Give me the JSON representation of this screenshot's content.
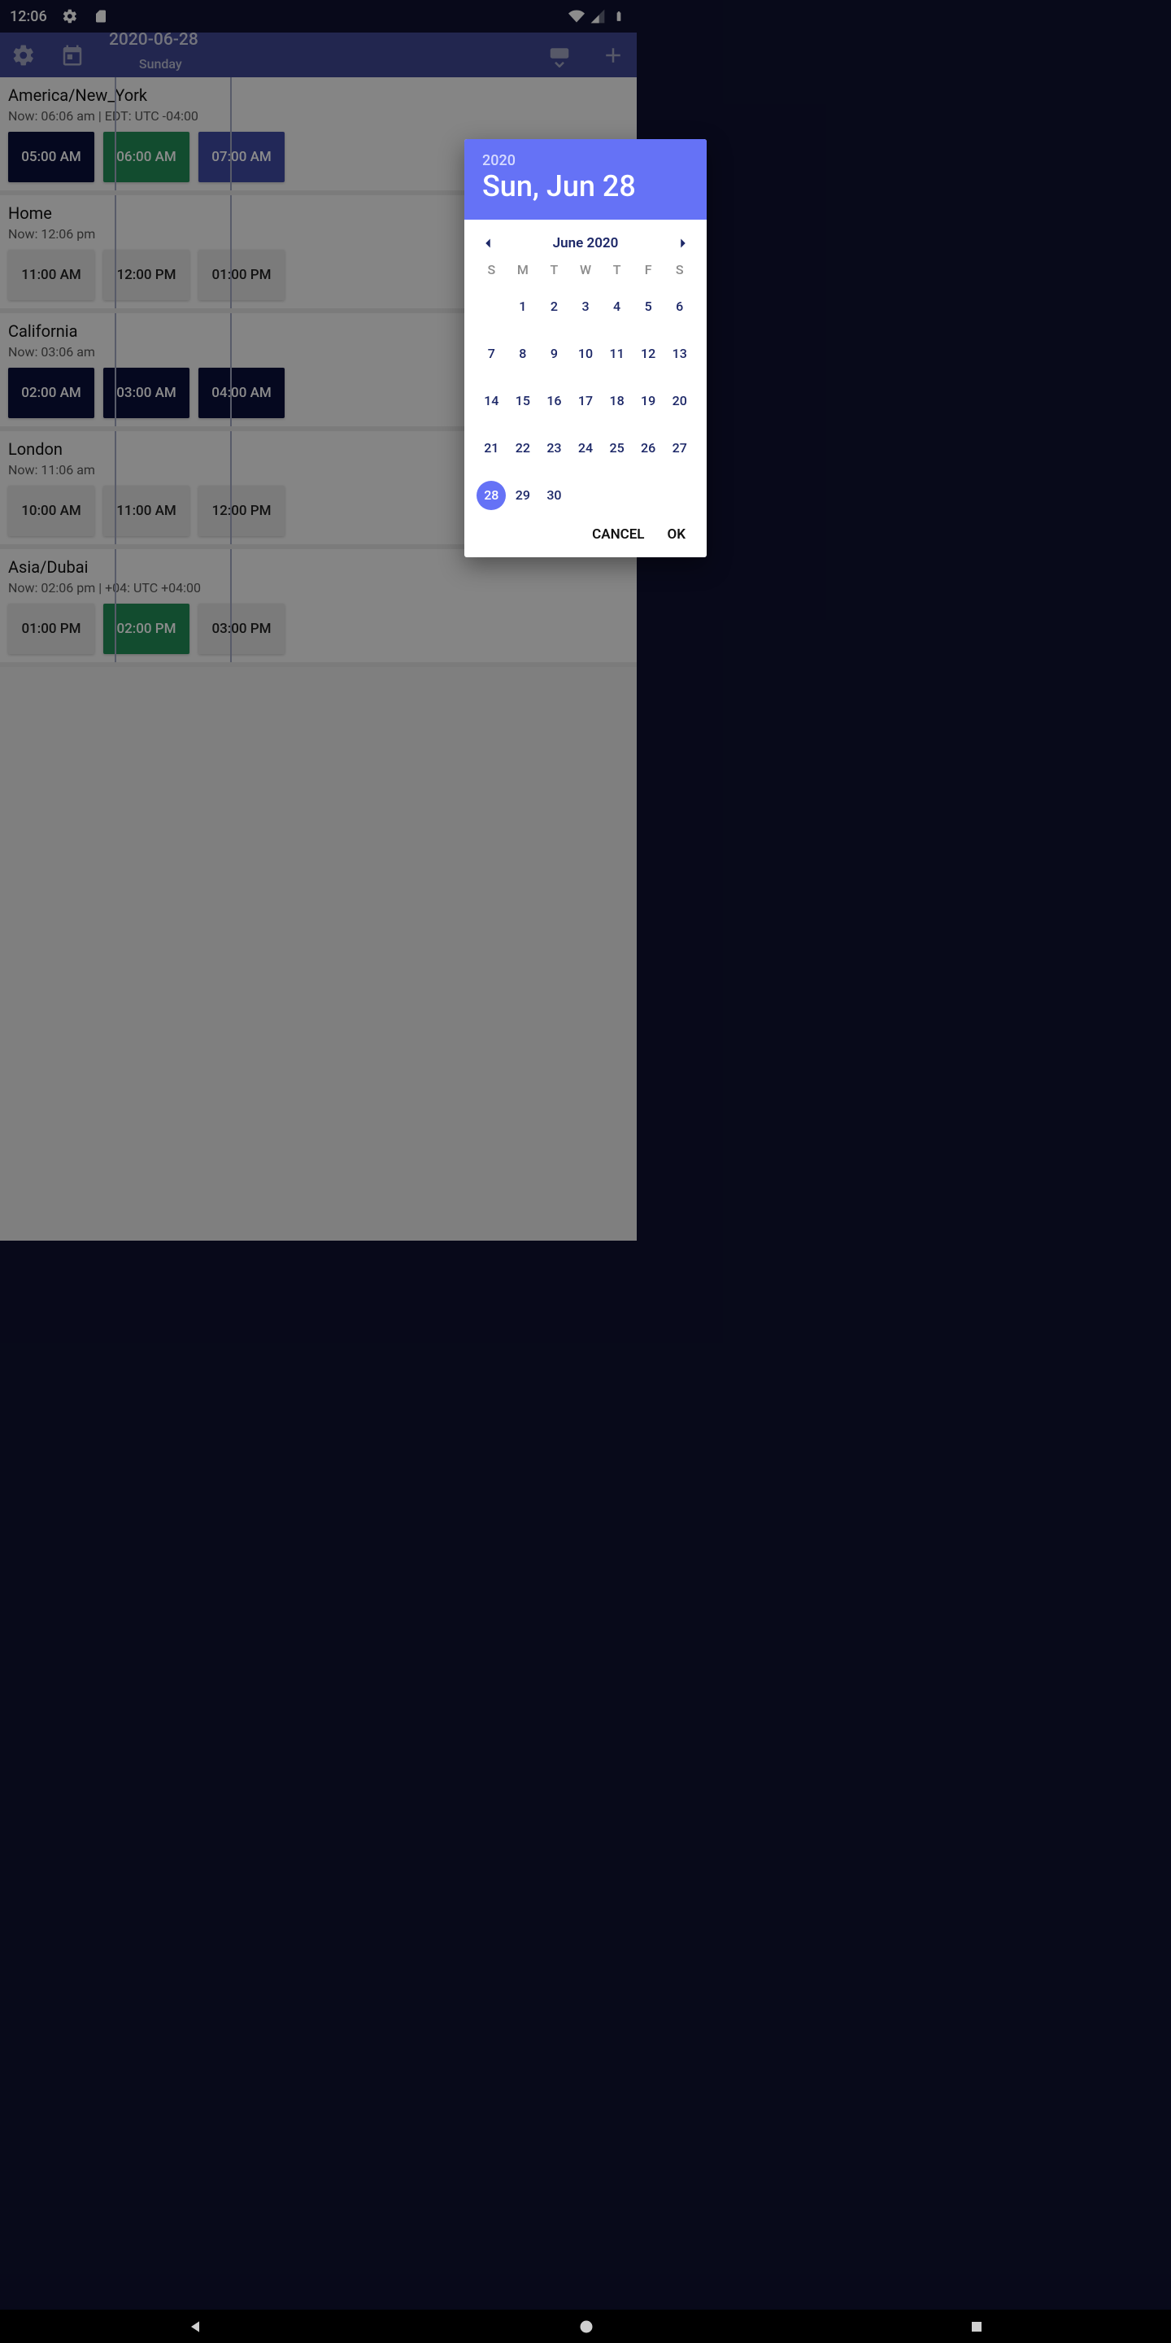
{
  "status_bar": {
    "time": "12:06",
    "icons": [
      "gear-icon",
      "sd-card-icon",
      "wifi-icon",
      "signal-icon",
      "battery-icon"
    ]
  },
  "header": {
    "date": "2020-06-28",
    "day": "Sunday"
  },
  "zones": [
    {
      "title": "America/New_York",
      "sub": "Now: 06:06 am | EDT: UTC -04:00",
      "times": [
        {
          "label": "05:00 AM",
          "style": "darknavy"
        },
        {
          "label": "06:00 AM",
          "style": "green"
        },
        {
          "label": "07:00 AM",
          "style": "navy"
        }
      ]
    },
    {
      "title": "Home",
      "sub": "Now: 12:06 pm",
      "times": [
        {
          "label": "11:00 AM",
          "style": "light"
        },
        {
          "label": "12:00 PM",
          "style": "light"
        },
        {
          "label": "01:00 PM",
          "style": "light"
        }
      ]
    },
    {
      "title": "California",
      "sub": "Now: 03:06 am",
      "times": [
        {
          "label": "02:00 AM",
          "style": "darknavy"
        },
        {
          "label": "03:00 AM",
          "style": "darknavy"
        },
        {
          "label": "04:00 AM",
          "style": "darknavy"
        }
      ]
    },
    {
      "title": "London",
      "sub": "Now: 11:06 am",
      "times": [
        {
          "label": "10:00 AM",
          "style": "light"
        },
        {
          "label": "11:00 AM",
          "style": "light"
        },
        {
          "label": "12:00 PM",
          "style": "light"
        }
      ]
    },
    {
      "title": "Asia/Dubai",
      "sub": "Now: 02:06 pm | +04: UTC +04:00",
      "times": [
        {
          "label": "01:00 PM",
          "style": "light"
        },
        {
          "label": "02:00 PM",
          "style": "green"
        },
        {
          "label": "03:00 PM",
          "style": "light"
        }
      ]
    }
  ],
  "dialog": {
    "year": "2020",
    "date_label": "Sun, Jun 28",
    "month_label": "June 2020",
    "dow": [
      "S",
      "M",
      "T",
      "W",
      "T",
      "F",
      "S"
    ],
    "first_day_offset": 1,
    "days_in_month": 30,
    "selected_day": 28,
    "cancel": "CANCEL",
    "ok": "OK"
  }
}
